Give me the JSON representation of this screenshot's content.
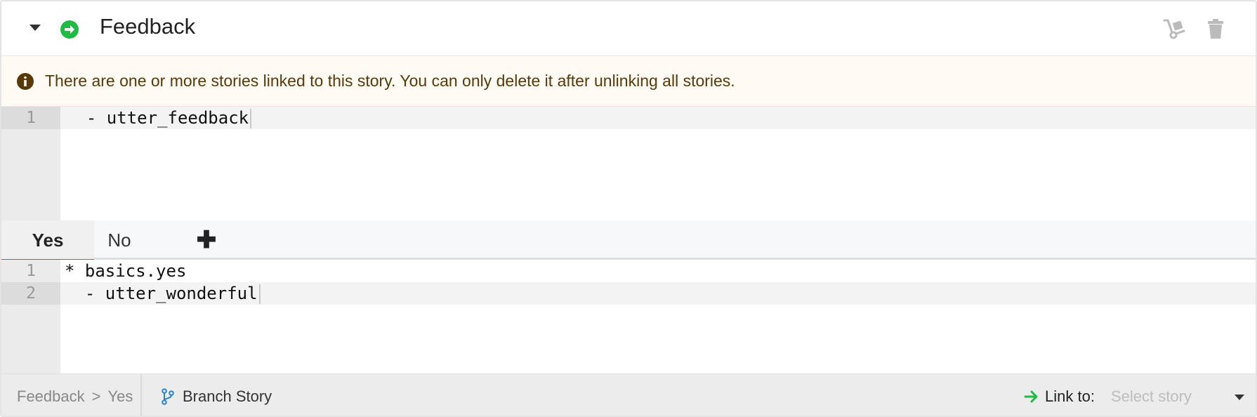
{
  "header": {
    "title": "Feedback",
    "collapse_icon": "caret-down-icon",
    "status_icon": "arrow-circle-right-icon",
    "move_icon": "dolly-icon",
    "delete_icon": "trash-icon",
    "colors": {
      "status_green": "#21ba45",
      "icon_gray": "#bbbbbb"
    }
  },
  "warning": {
    "icon": "info-circle-icon",
    "message": "There are one or more stories linked to this story. You can only delete it after unlinking all stories."
  },
  "story_editor": {
    "lines": [
      {
        "number": "1",
        "code": "  - utter_feedback"
      }
    ]
  },
  "branch_tabs": {
    "tabs": [
      {
        "label": "Yes",
        "active": true
      },
      {
        "label": "No",
        "active": false
      }
    ],
    "add_label": "✚"
  },
  "branch_editor": {
    "lines": [
      {
        "number": "1",
        "code": "* basics.yes"
      },
      {
        "number": "2",
        "code": "  - utter_wonderful"
      }
    ]
  },
  "footer": {
    "breadcrumb": [
      "Feedback",
      "Yes"
    ],
    "breadcrumb_separator": ">",
    "branch_button": "Branch Story",
    "link_label": "Link to:",
    "link_select_placeholder": "Select story",
    "colors": {
      "accent_blue": "#2185d0",
      "link_green": "#21ba45"
    }
  }
}
